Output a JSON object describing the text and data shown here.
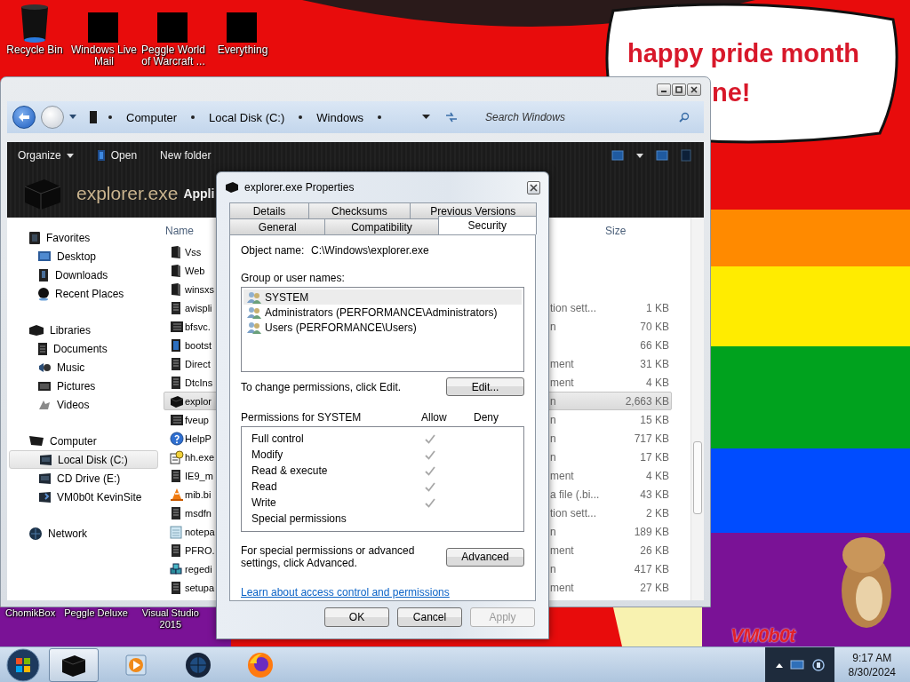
{
  "desktop": {
    "icons": [
      {
        "label": "Recycle Bin",
        "kind": "bin"
      },
      {
        "label": "Windows Live Mail",
        "kind": "redacted"
      },
      {
        "label": "Peggle World of Warcraft ...",
        "kind": "redacted"
      },
      {
        "label": "Everything",
        "kind": "redacted"
      }
    ],
    "lower_icons": [
      {
        "label": "ChomikBox"
      },
      {
        "label": "Peggle Deluxe"
      },
      {
        "label": "Visual Studio 2015"
      }
    ],
    "wallpaper": {
      "kind": "picture",
      "bubble_lines": [
        "happy pride month",
        "ne!"
      ],
      "signature": "VM0b0t"
    }
  },
  "explorer": {
    "breadcrumb": [
      "Computer",
      "Local Disk (C:)",
      "Windows"
    ],
    "search": {
      "placeholder": "Search Windows"
    },
    "commands": [
      "Organize",
      "Open",
      "New folder"
    ],
    "details": {
      "name": "explorer.exe",
      "type": "Appli"
    },
    "nav": [
      {
        "label": "Favorites",
        "kind": "star",
        "children": [
          {
            "label": "Desktop",
            "kind": "desktop",
            "selected": false
          },
          {
            "label": "Downloads",
            "kind": "download",
            "selected": false
          },
          {
            "label": "Recent Places",
            "kind": "recent",
            "selected": false
          }
        ]
      },
      {
        "label": "Libraries",
        "kind": "library",
        "children": [
          {
            "label": "Documents",
            "kind": "documents",
            "selected": false
          },
          {
            "label": "Music",
            "kind": "music",
            "selected": false
          },
          {
            "label": "Pictures",
            "kind": "pictures",
            "selected": false
          },
          {
            "label": "Videos",
            "kind": "videos",
            "selected": false
          }
        ]
      },
      {
        "label": "Computer",
        "kind": "computer",
        "children": [
          {
            "label": "Local Disk (C:)",
            "kind": "drive",
            "selected": true
          },
          {
            "label": "CD Drive (E:)",
            "kind": "drive",
            "selected": false
          },
          {
            "label": "VM0b0t KevinSite",
            "kind": "netdrive",
            "selected": false
          }
        ]
      },
      {
        "label": "Network",
        "kind": "network"
      }
    ],
    "columns": [
      "Name",
      "Size"
    ],
    "rows": [
      {
        "name": "Vss",
        "kind": "folder",
        "selected": false
      },
      {
        "name": "Web",
        "kind": "folder",
        "selected": false
      },
      {
        "name": "winsxs",
        "kind": "folder",
        "selected": false
      },
      {
        "name": "avispli",
        "kind": "document",
        "type": "tion sett...",
        "size": "1 KB",
        "selected": false
      },
      {
        "name": "bfsvc.",
        "kind": "window",
        "type": "n",
        "size": "70 KB",
        "selected": false
      },
      {
        "name": "bootst",
        "kind": "blue",
        "size": "66 KB",
        "selected": false
      },
      {
        "name": "Direct",
        "kind": "document",
        "type": "ment",
        "size": "31 KB",
        "selected": false
      },
      {
        "name": "DtcIns",
        "kind": "document",
        "type": "ment",
        "size": "4 KB",
        "selected": false
      },
      {
        "name": "explor",
        "kind": "box",
        "type": "n",
        "size": "2,663 KB",
        "selected": true
      },
      {
        "name": "fveup",
        "kind": "window",
        "type": "n",
        "size": "15 KB",
        "selected": false
      },
      {
        "name": "HelpP",
        "kind": "help",
        "type": "n",
        "size": "717 KB",
        "selected": false
      },
      {
        "name": "hh.exe",
        "kind": "helpdoc",
        "type": "n",
        "size": "17 KB",
        "selected": false
      },
      {
        "name": "IE9_m",
        "kind": "document",
        "type": "ment",
        "size": "4 KB",
        "selected": false
      },
      {
        "name": "mib.bi",
        "kind": "cone",
        "type": "a file (.bi...",
        "size": "43 KB",
        "selected": false
      },
      {
        "name": "msdfn",
        "kind": "document",
        "type": "tion sett...",
        "size": "2 KB",
        "selected": false
      },
      {
        "name": "notepa",
        "kind": "note",
        "type": "n",
        "size": "189 KB",
        "selected": false
      },
      {
        "name": "PFRO.",
        "kind": "document",
        "type": "ment",
        "size": "26 KB",
        "selected": false
      },
      {
        "name": "regedi",
        "kind": "cubes",
        "type": "n",
        "size": "417 KB",
        "selected": false
      },
      {
        "name": "setupa",
        "kind": "document",
        "type": "ment",
        "size": "27 KB",
        "selected": false
      }
    ]
  },
  "dialog": {
    "title": "explorer.exe Properties",
    "tab_rows": [
      [
        {
          "label": "Details",
          "selected": false
        },
        {
          "label": "Checksums",
          "selected": false
        },
        {
          "label": "Previous Versions",
          "selected": false
        }
      ],
      [
        {
          "label": "General",
          "selected": false
        },
        {
          "label": "Compatibility",
          "selected": false
        },
        {
          "label": "Security",
          "selected": true
        }
      ]
    ],
    "object_name": {
      "label": "Object name:",
      "value": "C:\\Windows\\explorer.exe"
    },
    "groups_label": "Group or user names:",
    "groups": [
      {
        "name": "SYSTEM",
        "selected": true
      },
      {
        "name": "Administrators (PERFORMANCE\\Administrators)",
        "selected": false
      },
      {
        "name": "Users (PERFORMANCE\\Users)",
        "selected": false
      }
    ],
    "edit_hint": "To change permissions, click Edit.",
    "edit_button": "Edit...",
    "permissions": {
      "title": "Permissions for SYSTEM",
      "allow": "Allow",
      "deny": "Deny",
      "rows": [
        {
          "name": "Full control",
          "allow": true
        },
        {
          "name": "Modify",
          "allow": true
        },
        {
          "name": "Read & execute",
          "allow": true
        },
        {
          "name": "Read",
          "allow": true
        },
        {
          "name": "Write",
          "allow": true
        },
        {
          "name": "Special permissions",
          "allow": false
        }
      ]
    },
    "advanced_hint": "For special permissions or advanced settings, click Advanced.",
    "advanced_button": "Advanced",
    "link": "Learn about access control and permissions",
    "buttons": [
      {
        "label": "OK",
        "disabled": false
      },
      {
        "label": "Cancel",
        "disabled": false
      },
      {
        "label": "Apply",
        "disabled": true
      }
    ]
  },
  "taskbar": {
    "items": [
      {
        "kind": "explorer",
        "selected": true
      },
      {
        "kind": "media",
        "selected": false
      },
      {
        "kind": "globe",
        "selected": false
      },
      {
        "kind": "firefox",
        "selected": false
      }
    ],
    "time": "9:17 AM",
    "date": "8/30/2024"
  }
}
